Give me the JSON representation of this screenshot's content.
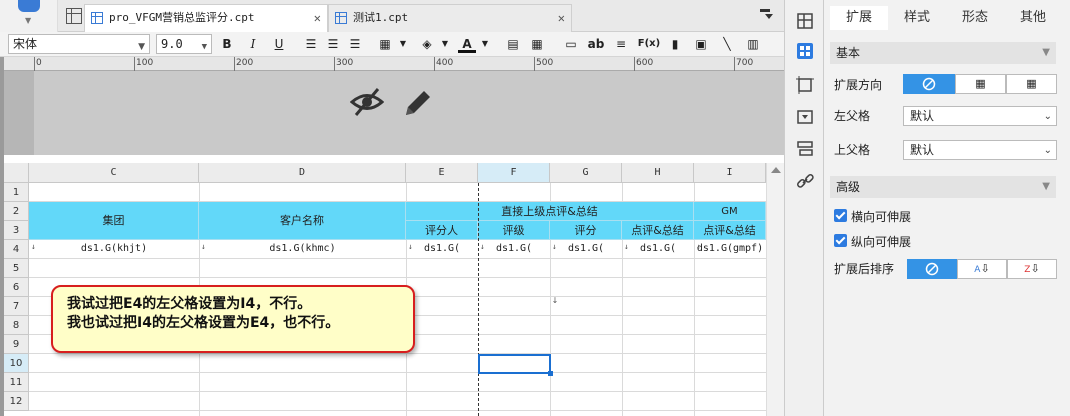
{
  "tabs": [
    {
      "label": "pro_VFGM营销总监评分.cpt"
    },
    {
      "label": "测试1.cpt"
    }
  ],
  "toolbar": {
    "font_family": "宋体",
    "font_size": "9.0",
    "bold": "B",
    "italic": "I",
    "underline": "U",
    "text_btn": "ab",
    "formula_btn": "F(x)"
  },
  "ruler": {
    "labels": [
      "0",
      "100",
      "200",
      "300",
      "400",
      "500",
      "600",
      "700"
    ]
  },
  "grid": {
    "columns": [
      "C",
      "D",
      "E",
      "F",
      "G",
      "H",
      "I"
    ],
    "rows": [
      "1",
      "2",
      "3",
      "4",
      "5",
      "6",
      "7",
      "8",
      "9",
      "10",
      "11",
      "12"
    ],
    "header": {
      "group": "集团",
      "customer": "客户名称",
      "direct": "直接上级点评&总结",
      "gm": "GM",
      "rater": "评分人",
      "grade": "评级",
      "score": "评分",
      "comment": "点评&总结",
      "gm_comment": "点评&总结"
    },
    "data_row": [
      "ds1.G(khjt)",
      "ds1.G(khmc)",
      "ds1.G(",
      "ds1.G(",
      "ds1.G(",
      "ds1.G(",
      "ds1.G(gmpf)"
    ],
    "selected_column": "F",
    "selected_row": "10"
  },
  "callout": {
    "line1": "我试过把E4的左父格设置为I4，不行。",
    "line2": "我也试过把I4的左父格设置为E4，也不行。"
  },
  "panel": {
    "tabs": [
      "扩展",
      "样式",
      "形态",
      "其他"
    ],
    "active_tab": "扩展",
    "basic_section": "基本",
    "expand_direction_label": "扩展方向",
    "left_parent_label": "左父格",
    "left_parent_value": "默认",
    "top_parent_label": "上父格",
    "top_parent_value": "默认",
    "advanced_section": "高级",
    "horizontal_expand": "横向可伸展",
    "vertical_expand": "纵向可伸展",
    "sort_label": "扩展后排序"
  }
}
